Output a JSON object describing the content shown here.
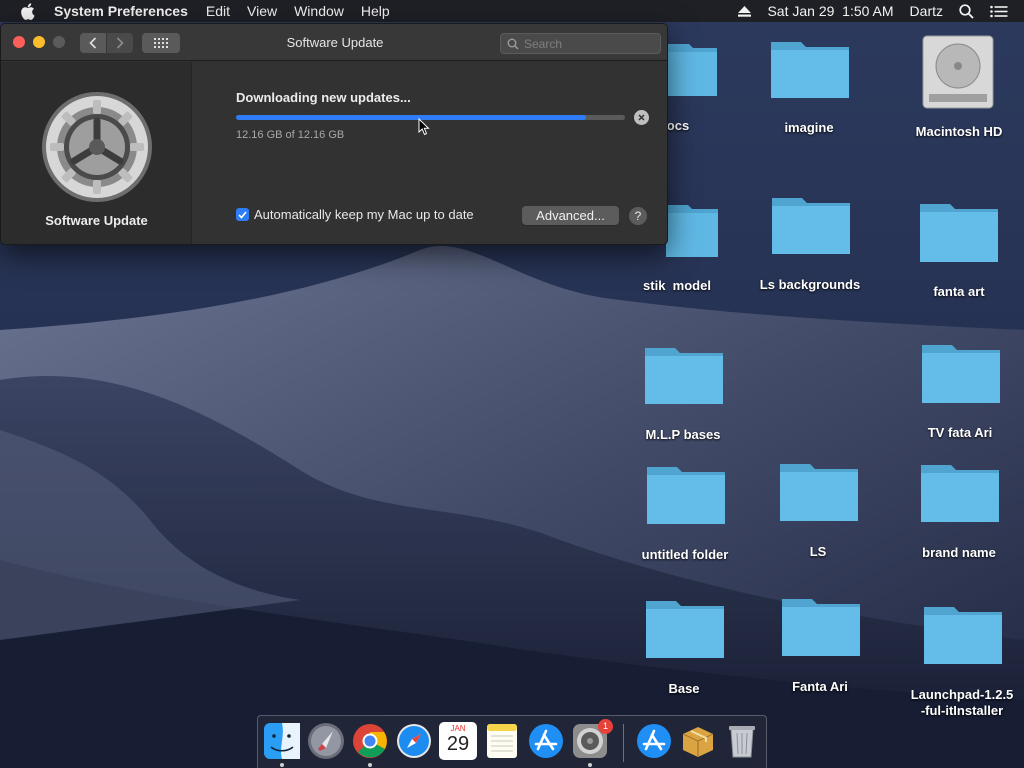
{
  "menubar": {
    "app_name": "System Preferences",
    "items": [
      "Edit",
      "View",
      "Window",
      "Help"
    ],
    "datetime": "Sat Jan 29  1:50 AM",
    "user": "Dartz"
  },
  "window": {
    "title": "Software Update",
    "search_placeholder": "Search",
    "sidebar_title": "Software Update",
    "status": "Downloading new updates...",
    "progress_fraction": 0.9,
    "progress_detail": "12.16 GB of 12.16 GB",
    "auto_update_label": "Automatically keep my Mac up to date",
    "auto_update_checked": true,
    "advanced_label": "Advanced...",
    "help_label": "?"
  },
  "desktop": {
    "items": [
      "ocs",
      "imagine",
      "Macintosh HD",
      "stik  model",
      "Ls backgrounds",
      "fanta art",
      "M.L.P bases",
      "TV fata Ari",
      "untitled folder",
      "LS",
      "brand name",
      "Base",
      "Fanta Ari",
      "Launchpad-1.2.5",
      "-ful-itInstaller"
    ]
  },
  "dock": {
    "calendar_month": "JAN",
    "calendar_day": "29",
    "sysprefs_badge": "1"
  }
}
